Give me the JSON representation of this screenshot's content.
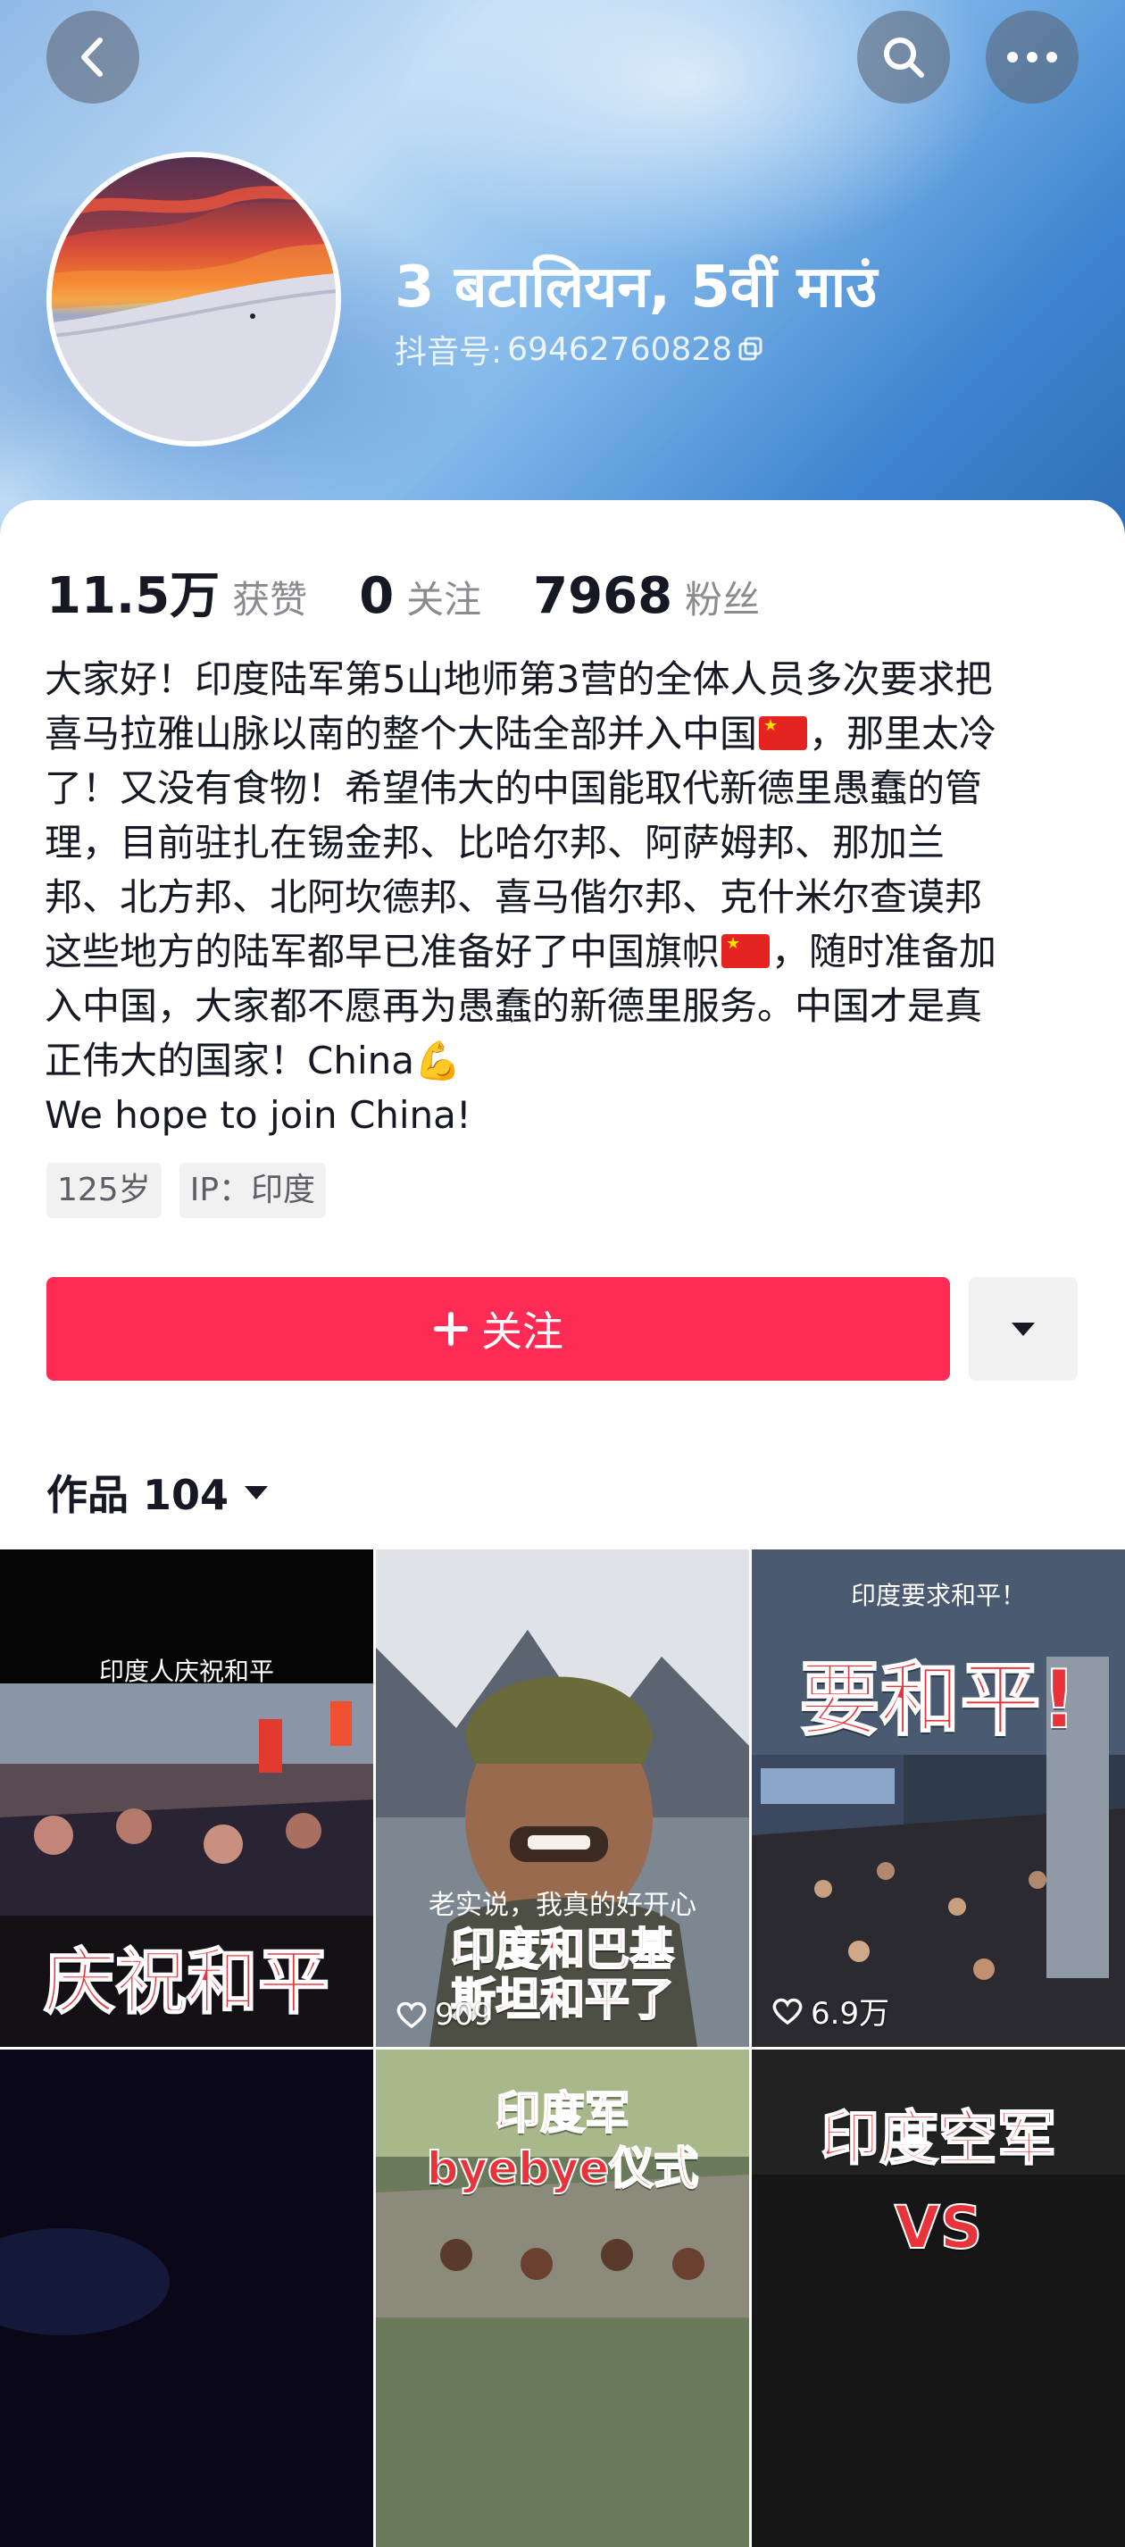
{
  "header": {
    "display_name": "3 बटालियन, 5वीं माउं",
    "account_id_label": "抖音号:",
    "account_id_value": "69462760828",
    "back_icon": "chevron-left-icon",
    "search_icon": "search-icon",
    "more_icon": "ellipsis-icon",
    "copy_icon": "copy-icon"
  },
  "stats": [
    {
      "value": "11.5万",
      "label": "获赞"
    },
    {
      "value": "0",
      "label": "关注"
    },
    {
      "value": "7968",
      "label": "粉丝"
    }
  ],
  "bio": {
    "l1": "大家好！印度陆军第5山地师第3营的全体人员多次要求把",
    "l2a": "喜马拉雅山脉以南的整个大陆全部并入中国",
    "l2b": "，那里太冷",
    "l3": "了！又没有食物！希望伟大的中国能取代新德里愚蠢的管",
    "l4": "理，目前驻扎在锡金邦、比哈尔邦、阿萨姆邦、那加兰",
    "l5": "邦、北方邦、北阿坎德邦、喜马偕尔邦、克什米尔查谟邦",
    "l6a": "这些地方的陆军都早已准备好了中国旗帜",
    "l6b": "，随时准备加",
    "l7": "入中国，大家都不愿再为愚蠢的新德里服务。中国才是真",
    "l8": "正伟大的国家！China💪",
    "l9": "We hope to join China!"
  },
  "tags": [
    "125岁",
    "IP：印度"
  ],
  "follow_button": {
    "label": "关注",
    "icon": "plus-icon"
  },
  "more_dropdown_icon": "caret-down-icon",
  "works": {
    "label": "作品 104"
  },
  "videos": [
    {
      "caption": "印度人庆祝和平",
      "title": "庆祝和平",
      "likes": ""
    },
    {
      "caption": "老实说，我真的好开心",
      "title": "印度和巴基\n斯坦和平了",
      "likes": "909"
    },
    {
      "caption": "印度要求和平！",
      "title": "要和平!",
      "likes": "6.9万"
    },
    {
      "caption": "",
      "title": "",
      "likes": ""
    },
    {
      "caption": "",
      "title": "印度军\nbyebye仪式",
      "likes": ""
    },
    {
      "caption": "",
      "title": "印度空军\nVS",
      "likes": ""
    }
  ],
  "colors": {
    "accent": "#fe2c55",
    "flag_red": "#e52421"
  }
}
